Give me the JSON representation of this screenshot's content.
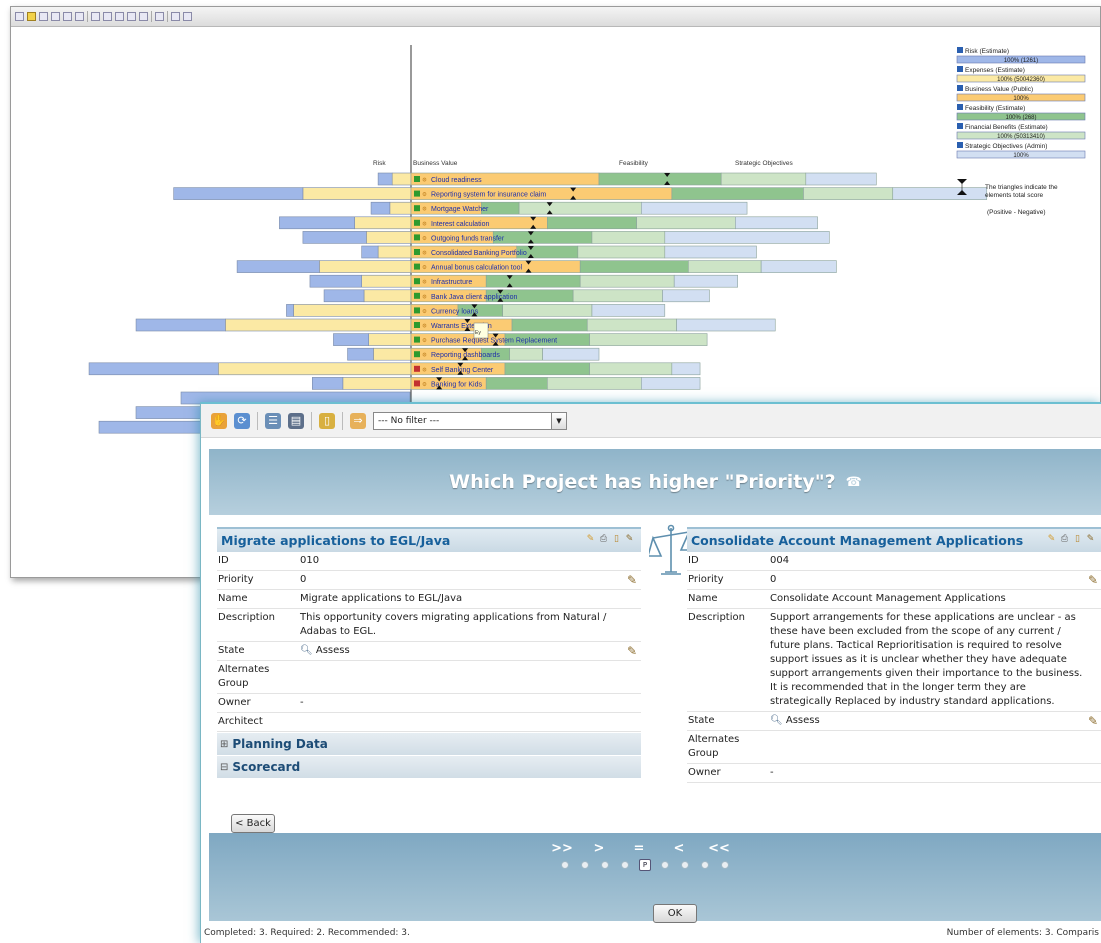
{
  "back_toolbar": {
    "icons": [
      "tree-icon",
      "chart-icon",
      "axis-icon",
      "axis-icon",
      "pie-icon",
      "tree-icon",
      "bar-chart-icon",
      "table-icon",
      "save-icon",
      "grid-icon",
      "export-icon",
      "page-icon",
      "print-icon",
      "arrow-icon"
    ]
  },
  "chart_data": {
    "type": "bar",
    "columns": [
      "Risk",
      "Business Value",
      "Feasibility",
      "Strategic Objectives"
    ],
    "categories": [
      "Cloud readiness",
      "Reporting system for insurance claim",
      "Mortgage Watcher",
      "Interest calculation",
      "Outgoing funds transfer",
      "Consolidated Banking Portfolio",
      "Annual bonus calculation tool",
      "Infrastructure",
      "Bank Java client application",
      "Currency loans",
      "Warrants Extension",
      "Purchase Request System Replacement",
      "Reporting dashboards",
      "Self Banking Center",
      "Banking for Kids"
    ],
    "flags": [
      "green",
      "green",
      "green",
      "green",
      "green",
      "green",
      "green",
      "green",
      "green",
      "green",
      "green",
      "green",
      "green",
      "red",
      "red"
    ],
    "series": [
      {
        "name": "Risk (Estimate)",
        "values": [
          -6,
          -55,
          -8,
          -32,
          -27,
          -7,
          -35,
          -22,
          -17,
          -3,
          -38,
          -15,
          -11,
          -55,
          -13
        ]
      },
      {
        "name": "Expenses (Estimate)",
        "values": [
          -8,
          -46,
          -9,
          -24,
          -19,
          -14,
          -39,
          -21,
          -20,
          -50,
          -79,
          -18,
          -16,
          -82,
          -29
        ]
      },
      {
        "name": "Business Value (Public)",
        "values": [
          80,
          111,
          30,
          58,
          35,
          45,
          72,
          32,
          32,
          20,
          43,
          40,
          30,
          40,
          32
        ]
      },
      {
        "name": "Feasibility (Estimate)",
        "values": [
          52,
          56,
          16,
          38,
          42,
          26,
          46,
          40,
          37,
          19,
          32,
          36,
          12,
          36,
          26
        ]
      },
      {
        "name": "Financial Benefits (Estimate)",
        "values": [
          36,
          38,
          52,
          42,
          31,
          37,
          31,
          40,
          38,
          38,
          38,
          50,
          14,
          35,
          40
        ]
      },
      {
        "name": "Strategic Objectives (Admin)",
        "values": [
          30,
          40,
          45,
          35,
          70,
          39,
          32,
          27,
          20,
          31,
          42,
          0,
          24,
          12,
          25
        ]
      }
    ],
    "score_markers": [
      {
        "total": [
          109,
          69,
          59,
          52,
          51,
          51,
          50,
          42,
          38,
          27,
          24,
          36,
          23,
          21,
          12
        ]
      }
    ],
    "legend": [
      {
        "label": "Risk (Estimate)",
        "value": "100% (1261)",
        "color": "#9fb7e8"
      },
      {
        "label": "Expenses (Estimate)",
        "value": "100% (50042360)",
        "color": "#fbe9a4"
      },
      {
        "label": "Business Value (Public)",
        "value": "100%",
        "color": "#fbcb73"
      },
      {
        "label": "Feasibility (Estimate)",
        "value": "100% (268)",
        "color": "#8fc48e"
      },
      {
        "label": "Financial Benefits (Estimate)",
        "value": "100% (50313410)",
        "color": "#cde4c6"
      },
      {
        "label": "Strategic Objectives (Admin)",
        "value": "100%",
        "color": "#d2dff2"
      }
    ],
    "legend_note": "The triangles indicate the elements total score",
    "legend_note2": "(Positive - Negative)",
    "tooltip": "Ey"
  },
  "toolbar": {
    "filter_value": "--- No filter ---"
  },
  "question": {
    "text": "Which Project has higher \"Priority\"?"
  },
  "left": {
    "title": "Migrate applications to EGL/Java",
    "fields": [
      {
        "label": "ID",
        "value": "010",
        "edit": false
      },
      {
        "label": "Priority",
        "value": "0",
        "edit": true
      },
      {
        "label": "Name",
        "value": "Migrate applications to EGL/Java",
        "edit": false
      },
      {
        "label": "Description",
        "value": "This opportunity covers migrating applications from Natural / Adabas to EGL.",
        "edit": false
      },
      {
        "label": "State",
        "value": "Assess",
        "edit": true,
        "search": true
      },
      {
        "label": "Alternates Group",
        "value": "",
        "edit": false
      },
      {
        "label": "Owner",
        "value": "-",
        "edit": false
      },
      {
        "label": "Architect",
        "value": "",
        "edit": false
      }
    ],
    "sections": [
      {
        "symbol": "⊞",
        "label": "Planning Data"
      },
      {
        "symbol": "⊟",
        "label": "Scorecard"
      }
    ]
  },
  "right": {
    "title": "Consolidate Account Management Applications",
    "fields": [
      {
        "label": "ID",
        "value": "004",
        "edit": false
      },
      {
        "label": "Priority",
        "value": "0",
        "edit": true
      },
      {
        "label": "Name",
        "value": "Consolidate Account Management Applications",
        "edit": false
      },
      {
        "label": "Description",
        "value": "Support arrangements for these applications are unclear - as these have been excluded from the scope of any current / future plans. Tactical Reprioritisation is required to resolve support issues as it is unclear whether they have adequate support arrangements given their importance to the business. It is recommended that in the longer term they are strategically Replaced by industry standard applications.",
        "edit": false
      },
      {
        "label": "State",
        "value": "Assess",
        "edit": true,
        "search": true
      },
      {
        "label": "Alternates Group",
        "value": "",
        "edit": false
      },
      {
        "label": "Owner",
        "value": "-",
        "edit": false
      }
    ]
  },
  "vote": {
    "labels": [
      ">>",
      ">",
      "=",
      "<",
      "<<"
    ],
    "selected_index": 4,
    "selected_mark": "P"
  },
  "buttons": {
    "back": "< Back",
    "ok": "OK"
  },
  "status": {
    "left": "Completed: 3. Required: 2. Recommended: 3.",
    "right": "Number of elements: 3. Comparis"
  },
  "colors": {
    "risk": "#9fb7e8",
    "expenses": "#fbe9a4",
    "business": "#fbcb73",
    "feasibility": "#8fc48e",
    "financial": "#cde4c6",
    "strategic": "#d2dff2",
    "accent": "#17609b",
    "header": "#8fb4c9"
  }
}
